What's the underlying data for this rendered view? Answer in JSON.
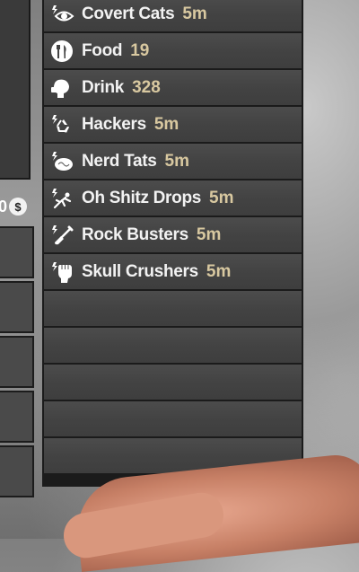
{
  "currency": {
    "amount": "0",
    "symbol": "$"
  },
  "buffs": [
    {
      "name": "Covert Cats",
      "value": "5m",
      "icon": "eye-icon"
    },
    {
      "name": "Food",
      "value": "19",
      "icon": "fork-knife-icon"
    },
    {
      "name": "Drink",
      "value": "328",
      "icon": "drink-head-icon"
    },
    {
      "name": "Hackers",
      "value": "5m",
      "icon": "recycle-icon"
    },
    {
      "name": "Nerd Tats",
      "value": "5m",
      "icon": "brain-icon"
    },
    {
      "name": "Oh Shitz Drops",
      "value": "5m",
      "icon": "falling-man-icon"
    },
    {
      "name": "Rock Busters",
      "value": "5m",
      "icon": "shovel-icon"
    },
    {
      "name": "Skull Crushers",
      "value": "5m",
      "icon": "fist-icon"
    }
  ],
  "empty_rows": 5,
  "colors": {
    "value_text": "#d8c8a0",
    "row_bg": "#454545",
    "panel_border": "#1b1b1b"
  }
}
